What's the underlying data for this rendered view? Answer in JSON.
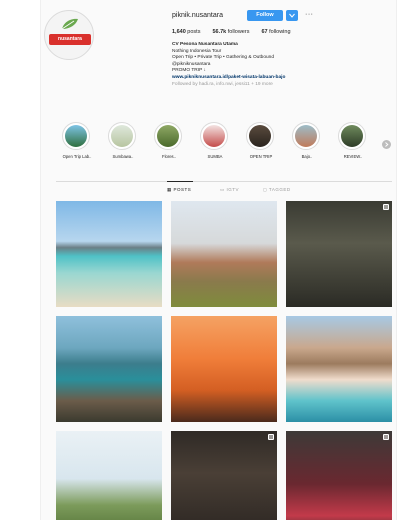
{
  "profile": {
    "username": "piknik.nusantara",
    "follow_label": "Follow",
    "more": "···",
    "logo_text": "nusantara",
    "stats": {
      "posts_value": "1,640",
      "posts_label": "posts",
      "followers_value": "56.7k",
      "followers_label": "followers",
      "following_value": "67",
      "following_label": "following"
    },
    "bio": {
      "name": "CV Pesona Nusantara Utama",
      "line1": "Nothing Indonesia Tour",
      "line2": "Open Trip • Private Trip • Gathering & Outbound",
      "line3": "@pikniknusantara",
      "line4": "PROMO TRIP ↓",
      "link": "www.pikniknusantara.id/paket-wisata-labuan-bajo",
      "followed": "Followed by hadi.ra, info.nwi, jessi11 + 19 more"
    }
  },
  "highlights": [
    {
      "label": "Open Trip Lab..",
      "colors": [
        "#7ec4e6",
        "#2f6f3e"
      ]
    },
    {
      "label": "Sumbawa..",
      "colors": [
        "#dfe8dc",
        "#b7c5a0"
      ]
    },
    {
      "label": "Flores..",
      "colors": [
        "#8fa865",
        "#4a6a2b"
      ]
    },
    {
      "label": "SUMBA",
      "colors": [
        "#f3e3e2",
        "#c44c4a"
      ]
    },
    {
      "label": "OPEN TRIP",
      "colors": [
        "#5a4b3e",
        "#2a241e"
      ]
    },
    {
      "label": "Bajo..",
      "colors": [
        "#9dbdc9",
        "#c07a5a"
      ]
    },
    {
      "label": "REVIEW..",
      "colors": [
        "#6f8b5d",
        "#2d3c27"
      ]
    }
  ],
  "tabs": {
    "posts": "▦ POSTS",
    "igtv": "▭ IGTV",
    "tagged": "◻ TAGGED"
  },
  "posts": [
    {
      "name": "beach-mountain",
      "bg": "linear-gradient(180deg,#7fb8e6 0%,#b7d6ee 38%,#6b7f86 44%,#4fc1c6 52%,#9ad7d1 68%,#e8dcc4 100%)",
      "multi": false
    },
    {
      "name": "temple-towers",
      "bg": "linear-gradient(180deg,#dfe7ef 0%,#d6d9da 40%,#b07a5a 58%,#8a7a4c 76%,#7f8c3c 100%)",
      "multi": false
    },
    {
      "name": "letters-dark",
      "bg": "linear-gradient(180deg,#3a3b33 0%,#5a5a4c 40%,#2b2b25 100%)",
      "multi": true
    },
    {
      "name": "island-rock",
      "bg": "linear-gradient(180deg,#8fc0dc 0%,#6da7bf 30%,#3c7d8c 45%,#2a8f9b 60%,#6b5c4a 80%,#3b3a2f 100%)",
      "multi": false
    },
    {
      "name": "sunset-silhouette",
      "bg": "linear-gradient(180deg,#f5a263 0%,#f07e3a 40%,#d45f23 70%,#4b2a1c 100%)",
      "multi": false
    },
    {
      "name": "pink-beach",
      "bg": "linear-gradient(180deg,#a7c9e4 0%,#c9a88d 30%,#9c7b5e 45%,#f0dccc 60%,#5fc3cb 80%,#2c8fa6 100%)",
      "multi": false
    },
    {
      "name": "trip-poster",
      "bg": "linear-gradient(180deg,#eaf1f5 0%,#d8e6ee 45%,#7c9b5b 70%,#4f6e33 100%)",
      "multi": false
    },
    {
      "name": "portrait-dark",
      "bg": "linear-gradient(180deg,#2f2a26 0%,#4a3f36 40%,#2a2521 100%)",
      "multi": true
    },
    {
      "name": "group-red",
      "bg": "linear-gradient(180deg,#3d3a38 0%,#6a2830 50%,#c33a4a 80%,#2d2a29 100%)",
      "multi": true
    }
  ]
}
